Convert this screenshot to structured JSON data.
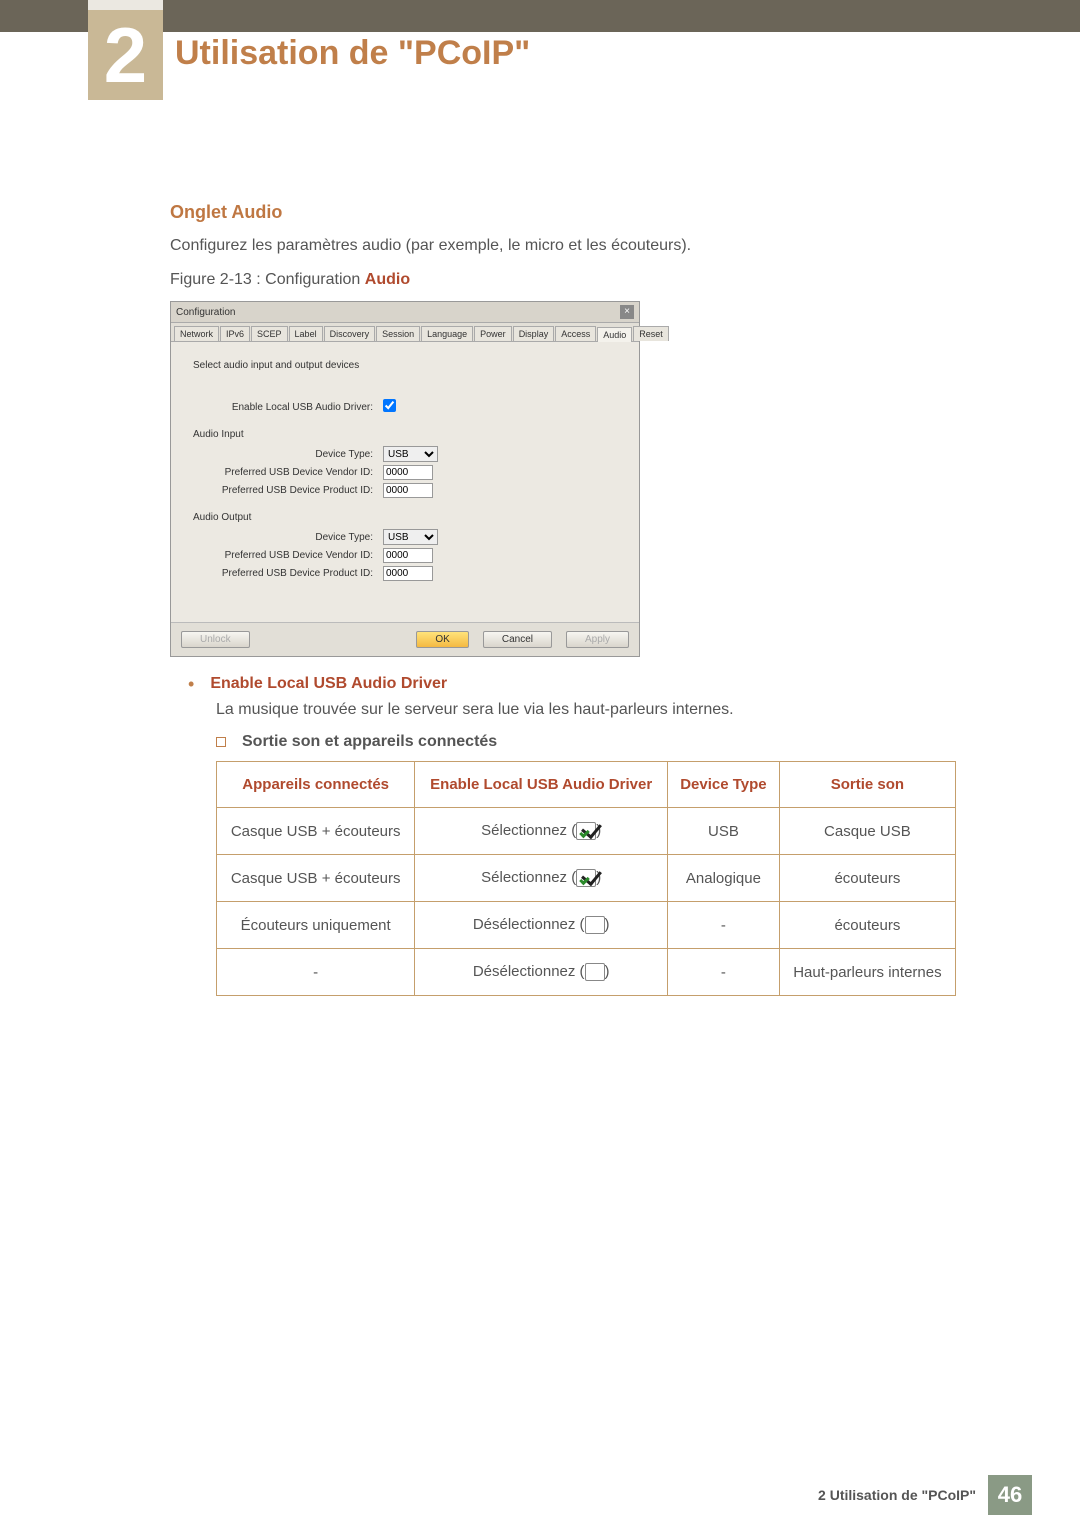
{
  "chapter": {
    "number": "2",
    "title": "Utilisation de \"PCoIP\""
  },
  "section": {
    "heading": "Onglet Audio",
    "intro": "Configurez les paramètres audio (par exemple, le micro et les écouteurs).",
    "figure_prefix": "Figure 2-13 : Configuration ",
    "figure_bold": "Audio"
  },
  "config": {
    "title": "Configuration",
    "tabs": [
      "Network",
      "IPv6",
      "SCEP",
      "Label",
      "Discovery",
      "Session",
      "Language",
      "Power",
      "Display",
      "Access",
      "Audio",
      "Reset"
    ],
    "active_tab": "Audio",
    "instruction": "Select audio input and output devices",
    "enable_label": "Enable Local USB Audio Driver:",
    "input_heading": "Audio Input",
    "output_heading": "Audio Output",
    "device_type_label": "Device Type:",
    "vendor_label": "Preferred USB Device Vendor ID:",
    "product_label": "Preferred USB Device Product ID:",
    "device_type_value": "USB",
    "vendor_value": "0000",
    "product_value": "0000",
    "buttons": {
      "unlock": "Unlock",
      "ok": "OK",
      "cancel": "Cancel",
      "apply": "Apply"
    }
  },
  "bullet": {
    "title": "Enable Local USB Audio Driver",
    "desc": "La musique trouvée sur le serveur sera lue via les haut-parleurs internes.",
    "sub_title": "Sortie son et appareils connectés"
  },
  "table": {
    "headers": {
      "col1": "Appareils connectés",
      "col2": "Enable Local USB Audio Driver",
      "col3": "Device Type",
      "col4": "Sortie son"
    },
    "select_word": "Sélectionnez (",
    "deselect_word": "Désélectionnez (",
    "close_paren": ")",
    "rows": [
      {
        "devices": "Casque USB + écouteurs",
        "driver": "select",
        "type": "USB",
        "out": "Casque USB"
      },
      {
        "devices": "Casque USB + écouteurs",
        "driver": "select",
        "type": "Analogique",
        "out": "écouteurs"
      },
      {
        "devices": "Écouteurs uniquement",
        "driver": "deselect",
        "type": "-",
        "out": "écouteurs"
      },
      {
        "devices": "-",
        "driver": "deselect",
        "type": "-",
        "out": "Haut-parleurs internes"
      }
    ]
  },
  "footer": {
    "text": "2 Utilisation de \"PCoIP\"",
    "page": "46"
  }
}
